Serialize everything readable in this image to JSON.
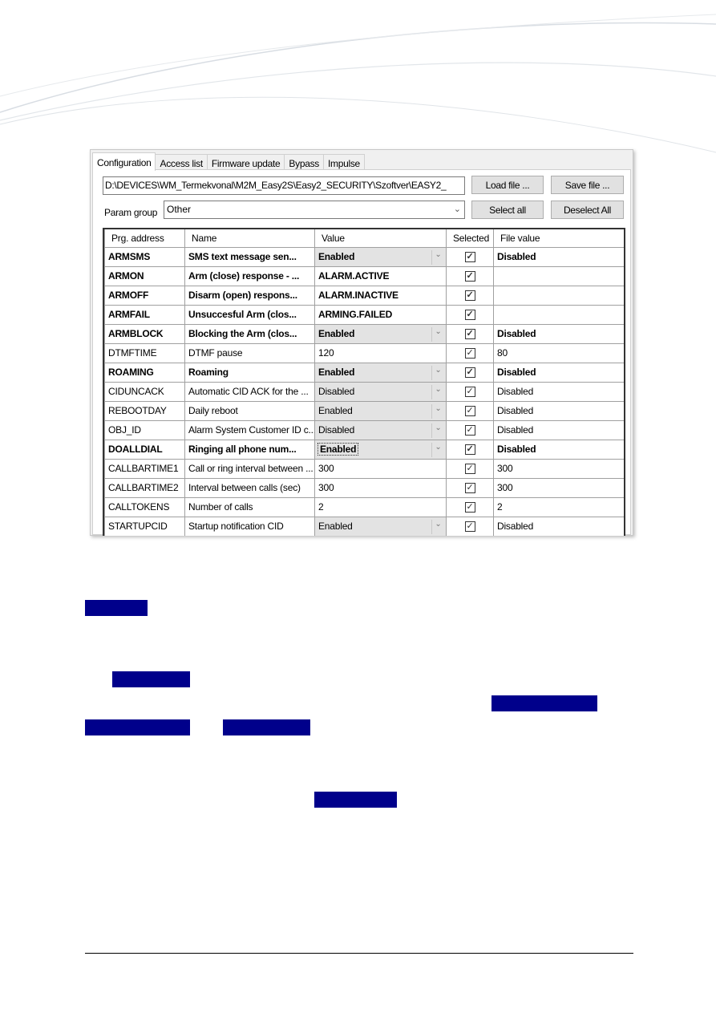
{
  "app": {
    "tabs": [
      {
        "label": "Configuration",
        "active": true
      },
      {
        "label": "Access list"
      },
      {
        "label": "Firmware update"
      },
      {
        "label": "Bypass"
      },
      {
        "label": "Impulse"
      }
    ],
    "file_path": "D:\\DEVICES\\WM_Termekvonal\\M2M_Easy2S\\Easy2_SECURITY\\Szoftver\\EASY2_",
    "load_file_label": "Load file ...",
    "save_file_label": "Save file ...",
    "param_group_label": "Param group",
    "param_group_value": "Other",
    "select_all_label": "Select all",
    "deselect_all_label": "Deselect All",
    "columns": [
      "Prg. address",
      "Name",
      "Value",
      "Selected",
      "File value"
    ],
    "rows": [
      {
        "address": "ARMSMS",
        "name": "SMS text message sen...",
        "value": "Enabled",
        "dropdown": true,
        "selected": true,
        "file_value": "Disabled",
        "bold": true
      },
      {
        "address": "ARMON",
        "name": "Arm (close) response - ...",
        "value": "ALARM.ACTIVE",
        "dropdown": false,
        "selected": true,
        "file_value": "",
        "bold": true
      },
      {
        "address": "ARMOFF",
        "name": "Disarm (open) respons...",
        "value": "ALARM.INACTIVE",
        "dropdown": false,
        "selected": true,
        "file_value": "",
        "bold": true
      },
      {
        "address": "ARMFAIL",
        "name": "Unsuccesful Arm (clos...",
        "value": "ARMING.FAILED",
        "dropdown": false,
        "selected": true,
        "file_value": "",
        "bold": true
      },
      {
        "address": "ARMBLOCK",
        "name": "Blocking the Arm (clos...",
        "value": "Enabled",
        "dropdown": true,
        "selected": true,
        "file_value": "Disabled",
        "bold": true
      },
      {
        "address": "DTMFTIME",
        "name": "DTMF pause",
        "value": "120",
        "dropdown": false,
        "selected": true,
        "file_value": "80",
        "bold": false
      },
      {
        "address": "ROAMING",
        "name": "Roaming",
        "value": "Enabled",
        "dropdown": true,
        "selected": true,
        "file_value": "Disabled",
        "bold": true
      },
      {
        "address": "CIDUNCACK",
        "name": "Automatic CID ACK for the ...",
        "value": "Disabled",
        "dropdown": true,
        "selected": true,
        "file_value": "Disabled",
        "bold": false
      },
      {
        "address": "REBOOTDAY",
        "name": "Daily reboot",
        "value": "Enabled",
        "dropdown": true,
        "selected": true,
        "file_value": "Disabled",
        "bold": false
      },
      {
        "address": "OBJ_ID",
        "name": "Alarm System Customer ID c...",
        "value": "Disabled",
        "dropdown": true,
        "selected": true,
        "file_value": "Disabled",
        "bold": false
      },
      {
        "address": "DOALLDIAL",
        "name": "Ringing all phone num...",
        "value": "Enabled",
        "dropdown": true,
        "focused": true,
        "selected": true,
        "file_value": "Disabled",
        "bold": true
      },
      {
        "address": "CALLBARTIME1",
        "name": "Call or ring interval between ...",
        "value": "300",
        "dropdown": false,
        "selected": true,
        "file_value": "300",
        "bold": false
      },
      {
        "address": "CALLBARTIME2",
        "name": "Interval between calls (sec)",
        "value": "300",
        "dropdown": false,
        "selected": true,
        "file_value": "300",
        "bold": false
      },
      {
        "address": "CALLTOKENS",
        "name": "Number of calls",
        "value": "2",
        "dropdown": false,
        "selected": true,
        "file_value": "2",
        "bold": false
      },
      {
        "address": "STARTUPCID",
        "name": "Startup notification CID",
        "value": "Enabled",
        "dropdown": true,
        "selected": true,
        "file_value": "Disabled",
        "bold": false
      }
    ]
  },
  "colors": {
    "redaction": "#00008b",
    "dropdown_bg": "#e3e3e3",
    "button_bg": "#e1e1e1"
  },
  "icons": {
    "check": "checkbox-checked-icon",
    "chevron": "chevron-down-icon"
  }
}
